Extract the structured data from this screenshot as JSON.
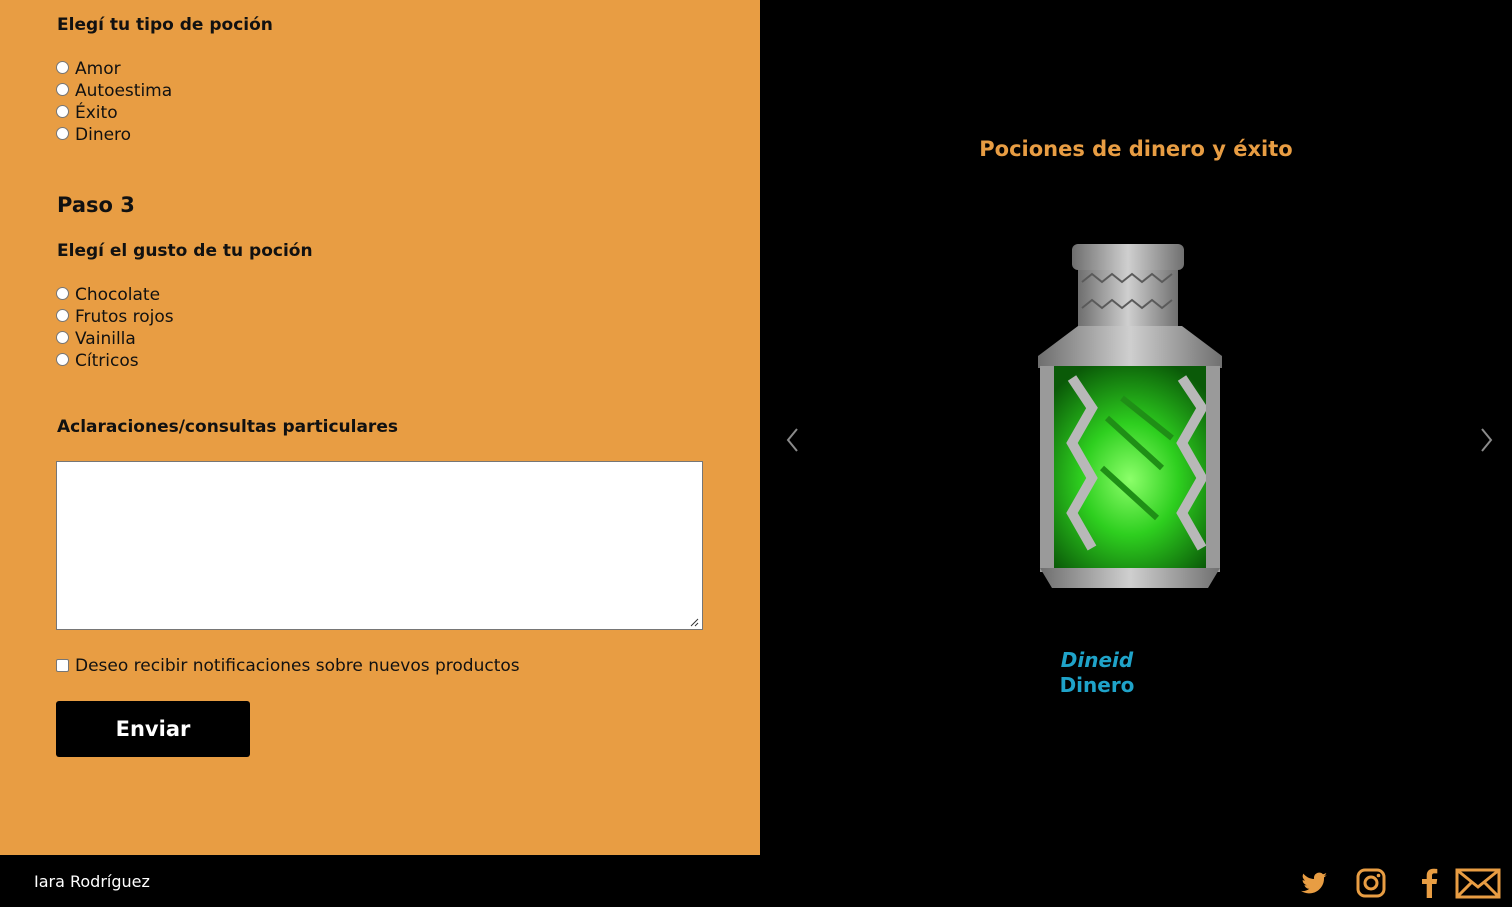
{
  "form": {
    "type_question": "Elegí tu tipo de poción",
    "type_options": [
      "Amor",
      "Autoestima",
      "Éxito",
      "Dinero"
    ],
    "step3_title": "Paso 3",
    "flavor_question": "Elegí el gusto de tu poción",
    "flavor_options": [
      "Chocolate",
      "Frutos rojos",
      "Vainilla",
      "Cítricos"
    ],
    "notes_label": "Aclaraciones/consultas particulares",
    "notes_value": "",
    "newsletter_label": "Deseo recibir notificaciones sobre nuevos productos",
    "newsletter_checked": false,
    "submit_label": "Enviar"
  },
  "carousel": {
    "title": "Pociones de dinero y éxito",
    "item_name": "Dineid",
    "item_category": "Dinero",
    "prev_icon": "chevron-left-icon",
    "next_icon": "chevron-right-icon"
  },
  "footer": {
    "author": "Iara Rodríguez",
    "icons": [
      "twitter-icon",
      "instagram-icon",
      "facebook-icon",
      "mail-icon"
    ]
  },
  "colors": {
    "form_bg": "#e89d43",
    "accent_orange": "#e89d43",
    "caption_blue": "#1fa3c9",
    "dark": "#000000"
  }
}
